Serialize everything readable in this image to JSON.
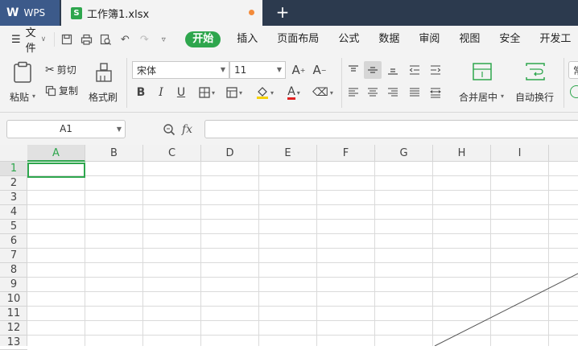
{
  "app": {
    "name": "WPS",
    "file_tab": "工作簿1.xlsx",
    "new_tab_symbol": "+"
  },
  "menu": {
    "file_label": "文件",
    "tabs": [
      "开始",
      "插入",
      "页面布局",
      "公式",
      "数据",
      "审阅",
      "视图",
      "安全",
      "开发工"
    ],
    "active_tab": "开始"
  },
  "ribbon": {
    "paste": "粘贴",
    "cut": "剪切",
    "copy": "复制",
    "format_painter": "格式刷",
    "font_name": "宋体",
    "font_size": "11",
    "merge_center": "合并居中",
    "wrap_text": "自动换行",
    "number_format_partial": "常"
  },
  "formula_bar": {
    "name_box": "A1",
    "fx_label": "fx",
    "formula_value": ""
  },
  "sheet": {
    "columns": [
      "A",
      "B",
      "C",
      "D",
      "E",
      "F",
      "G",
      "H",
      "I"
    ],
    "rows": [
      "1",
      "2",
      "3",
      "4",
      "5",
      "6",
      "7",
      "8",
      "9",
      "10",
      "11",
      "12",
      "13"
    ],
    "active_cell": "A1"
  },
  "colors": {
    "accent": "#2ea64d",
    "titlebar": "#2c3a4e",
    "wps_tab": "#3c5a8a"
  }
}
